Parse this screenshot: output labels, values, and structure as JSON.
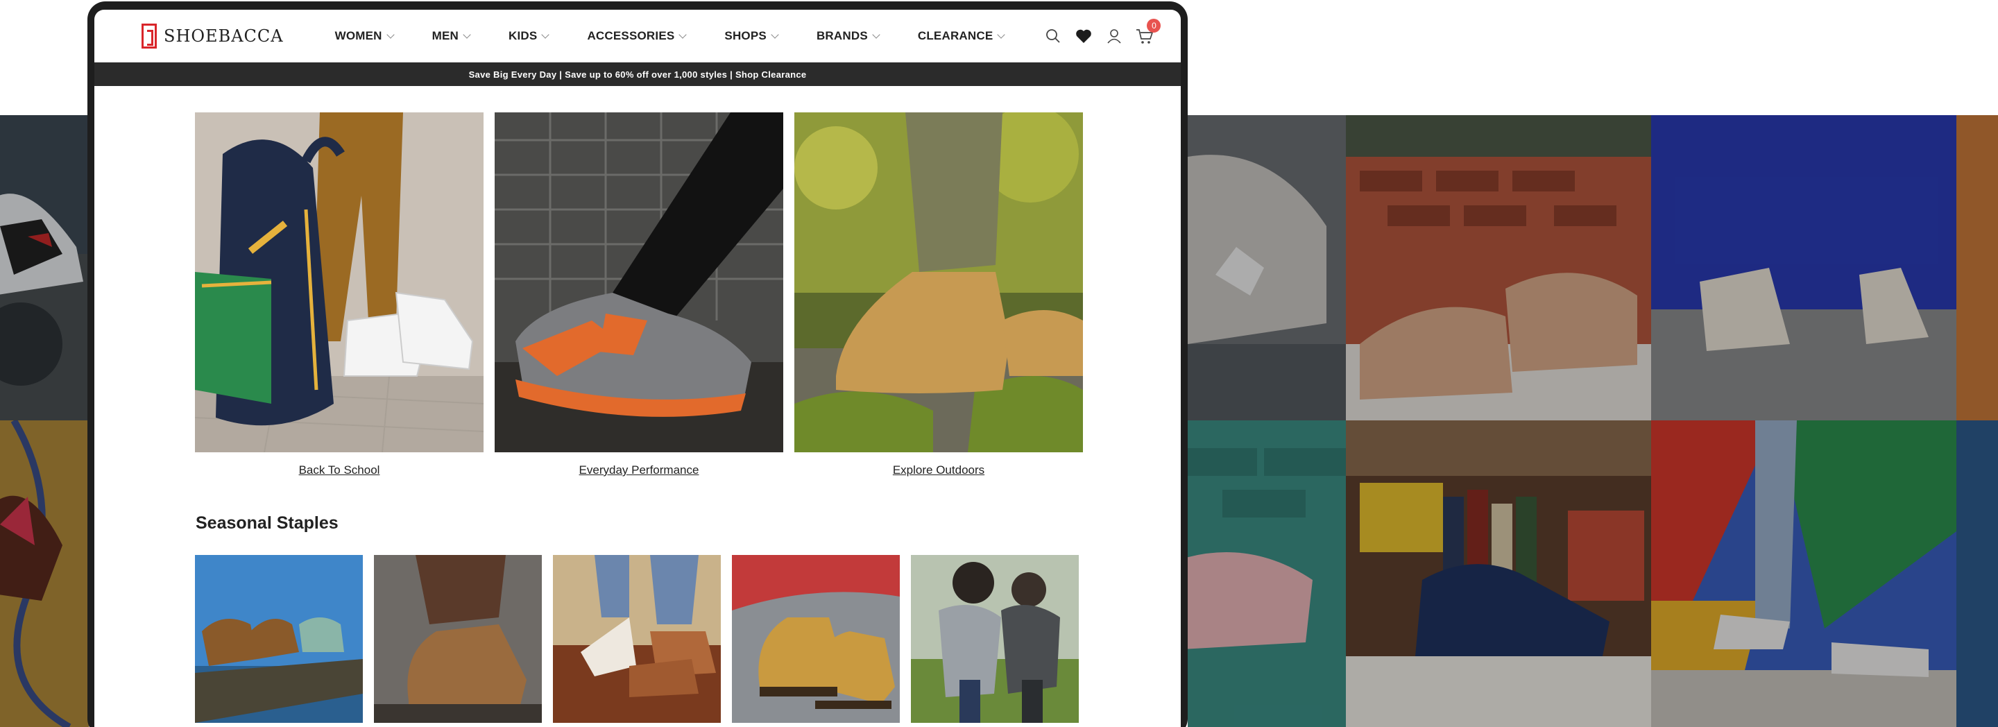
{
  "brand": {
    "name": "SHOEBACCA",
    "accent_color": "#d9252a"
  },
  "nav": {
    "items": [
      {
        "label": "WOMEN"
      },
      {
        "label": "MEN"
      },
      {
        "label": "KIDS"
      },
      {
        "label": "ACCESSORIES"
      },
      {
        "label": "SHOPS"
      },
      {
        "label": "BRANDS"
      },
      {
        "label": "CLEARANCE"
      }
    ]
  },
  "header_icons": {
    "search": "search-icon",
    "wishlist": "heart-icon",
    "account": "user-icon",
    "cart": "cart-icon",
    "cart_count": "0"
  },
  "promo": {
    "text": "Save Big Every Day | Save up to 60% off over 1,000 styles | Shop Clearance"
  },
  "categories": [
    {
      "label": "Back To School"
    },
    {
      "label": "Everyday Performance"
    },
    {
      "label": "Explore Outdoors"
    }
  ],
  "section": {
    "title": "Seasonal Staples"
  }
}
